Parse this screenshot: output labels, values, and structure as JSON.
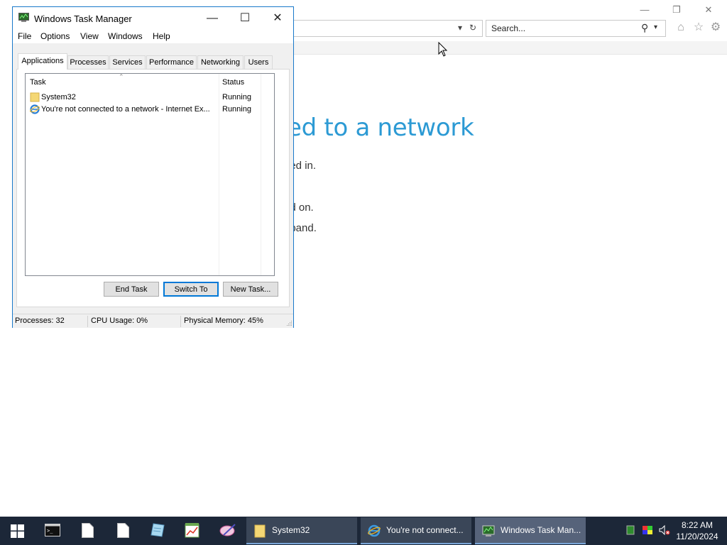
{
  "ie": {
    "search_placeholder": "Search...",
    "heading_partial": "ed to a network",
    "lines": [
      "ged in.",
      ".",
      "ed on.",
      "dband."
    ]
  },
  "task_manager": {
    "title": "Windows Task Manager",
    "menu": [
      "File",
      "Options",
      "View",
      "Windows",
      "Help"
    ],
    "tabs": [
      "Applications",
      "Processes",
      "Services",
      "Performance",
      "Networking",
      "Users"
    ],
    "active_tab": "Applications",
    "columns": {
      "task": "Task",
      "status": "Status"
    },
    "rows": [
      {
        "task": "System32",
        "status": "Running",
        "icon": "folder-icon"
      },
      {
        "task": "You're not connected to a network - Internet Ex...",
        "status": "Running",
        "icon": "internet-explorer-icon"
      }
    ],
    "buttons": {
      "end_task": "End Task",
      "switch_to": "Switch To",
      "new_task": "New Task..."
    },
    "status": {
      "processes": "Processes: 32",
      "cpu": "CPU Usage: 0%",
      "memory": "Physical Memory: 45%"
    }
  },
  "taskbar": {
    "tasks": [
      {
        "label": "System32",
        "icon": "folder-icon"
      },
      {
        "label": "You're not connect...",
        "icon": "internet-explorer-icon"
      },
      {
        "label": "Windows Task Man...",
        "icon": "task-manager-icon"
      }
    ],
    "clock": {
      "time": "8:22 AM",
      "date": "11/20/2024"
    }
  },
  "colors": {
    "accent": "#1979ca",
    "ie_heading": "#2c9ad4",
    "taskbar": "#1c2738"
  }
}
